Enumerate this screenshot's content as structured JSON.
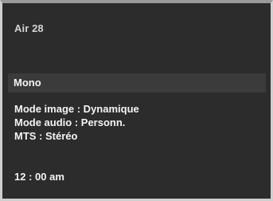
{
  "channel": {
    "label": "Air 28"
  },
  "audio_mode": {
    "label": "Mono"
  },
  "info": {
    "picture_mode": "Mode image : Dynamique",
    "sound_mode": "Mode audio : Personn.",
    "mts": "MTS : Stéréo"
  },
  "clock": {
    "time": "12 : 00 am"
  }
}
